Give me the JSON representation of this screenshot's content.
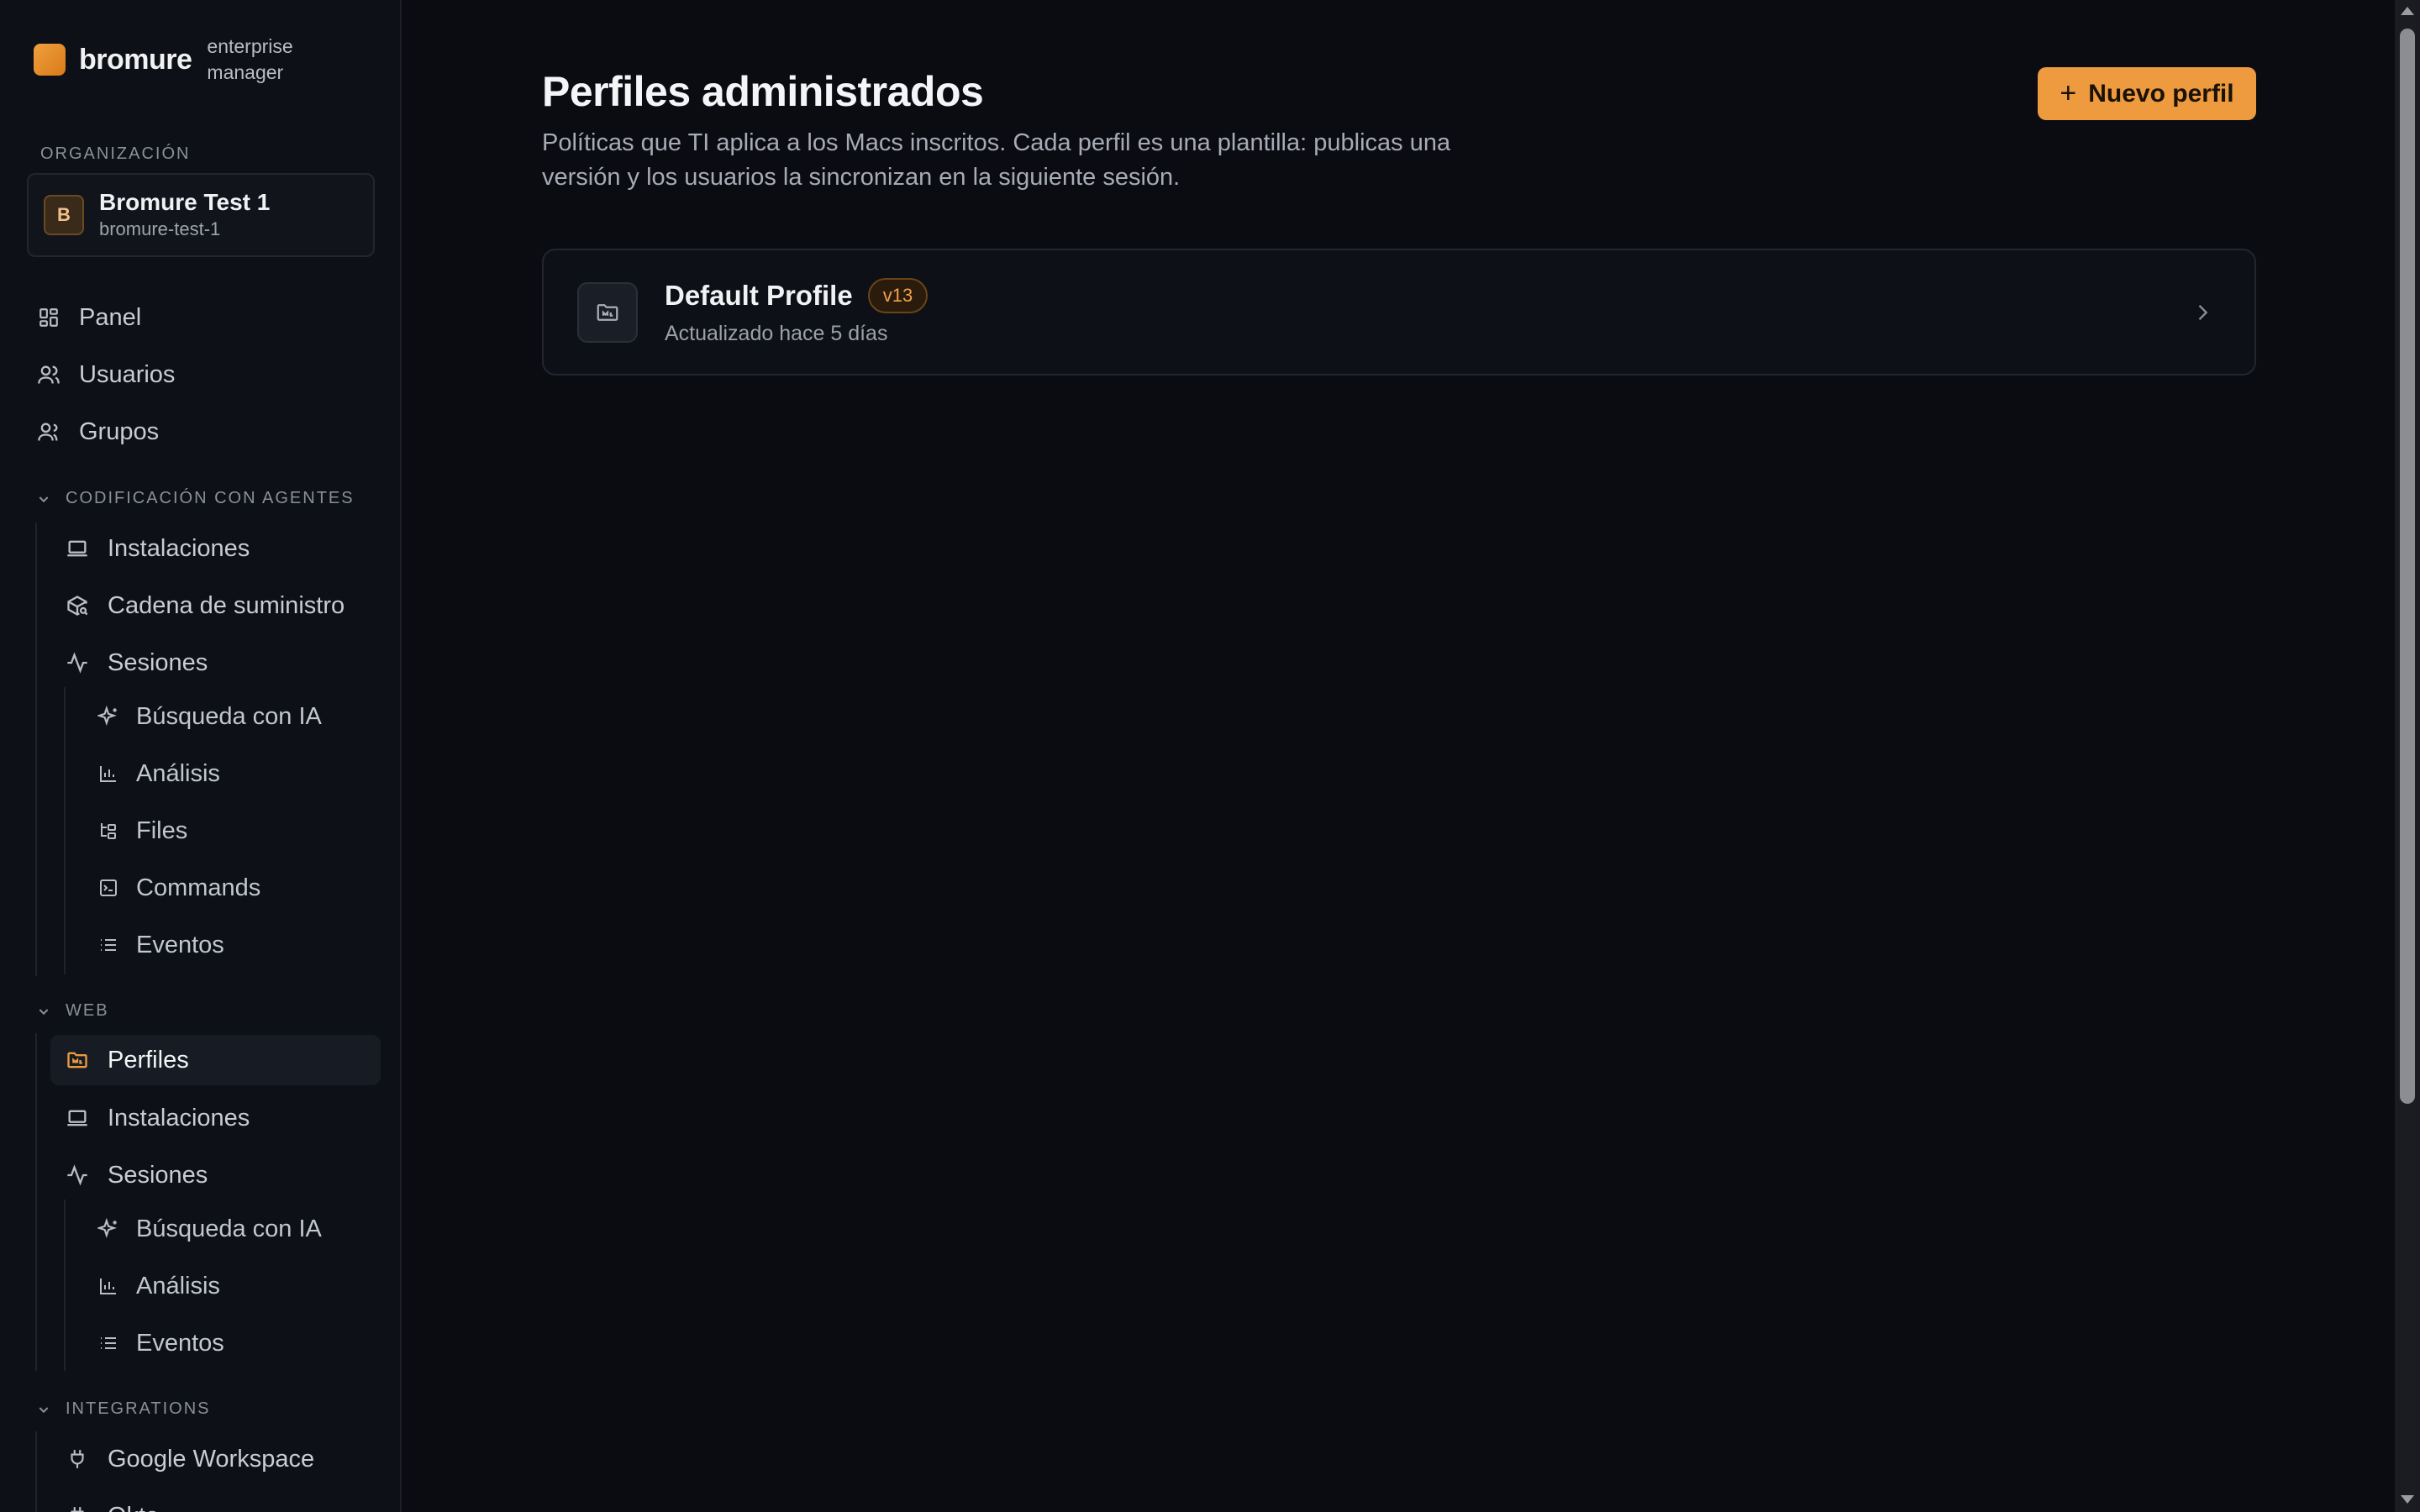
{
  "brand": {
    "name": "bromure",
    "subtitle": "enterprise manager"
  },
  "org": {
    "section_label": "ORGANIZACIÓN",
    "avatar_letter": "B",
    "name": "Bromure Test 1",
    "slug": "bromure-test-1"
  },
  "nav": {
    "panel": "Panel",
    "usuarios": "Usuarios",
    "grupos": "Grupos"
  },
  "agentic": {
    "section_label": "CODIFICACIÓN CON AGENTES",
    "instalaciones": "Instalaciones",
    "cadena": "Cadena de suministro",
    "sesiones": "Sesiones",
    "busqueda": "Búsqueda con IA",
    "analisis": "Análisis",
    "files": "Files",
    "commands": "Commands",
    "eventos": "Eventos"
  },
  "web": {
    "section_label": "WEB",
    "perfiles": "Perfiles",
    "instalaciones": "Instalaciones",
    "sesiones": "Sesiones",
    "busqueda": "Búsqueda con IA",
    "analisis": "Análisis",
    "eventos": "Eventos"
  },
  "integrations": {
    "section_label": "INTEGRATIONS",
    "google": "Google Workspace",
    "next": "Okta"
  },
  "main": {
    "title": "Perfiles administrados",
    "description": "Políticas que TI aplica a los Macs inscritos. Cada perfil es una plantilla: publicas una versión y los usuarios la sincronizan en la siguiente sesión.",
    "new_button": "Nuevo perfil"
  },
  "profiles": [
    {
      "name": "Default Profile",
      "version": "v13",
      "updated": "Actualizado hace 5 días"
    }
  ],
  "colors": {
    "accent": "#ee9a3e",
    "background": "#0a0c12",
    "sidebar": "#0d1017"
  }
}
